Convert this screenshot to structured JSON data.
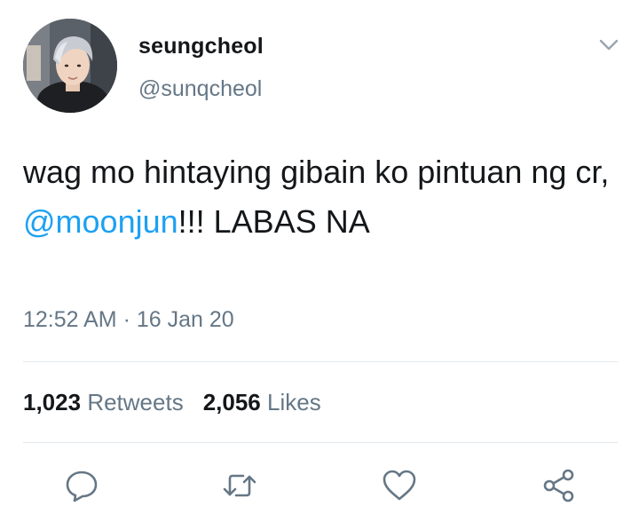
{
  "tweet": {
    "display_name": "seungcheol",
    "handle": "@sunqcheol",
    "text_before": "wag mo hintaying gibain ko pintuan ng cr, ",
    "mention": "@moonjun",
    "text_after": "!!! LABAS NA",
    "timestamp": "12:52 AM · 16 Jan 20",
    "retweet_count": "1,023",
    "retweet_label": "Retweets",
    "like_count": "2,056",
    "like_label": "Likes"
  },
  "icons": {
    "caret": "chevron-down-icon",
    "reply": "reply-icon",
    "retweet": "retweet-icon",
    "like": "heart-icon",
    "share": "share-icon"
  },
  "colors": {
    "link": "#1da1f2",
    "secondary_text": "#657786",
    "primary_text": "#14171a",
    "divider": "#e1e8ed"
  }
}
